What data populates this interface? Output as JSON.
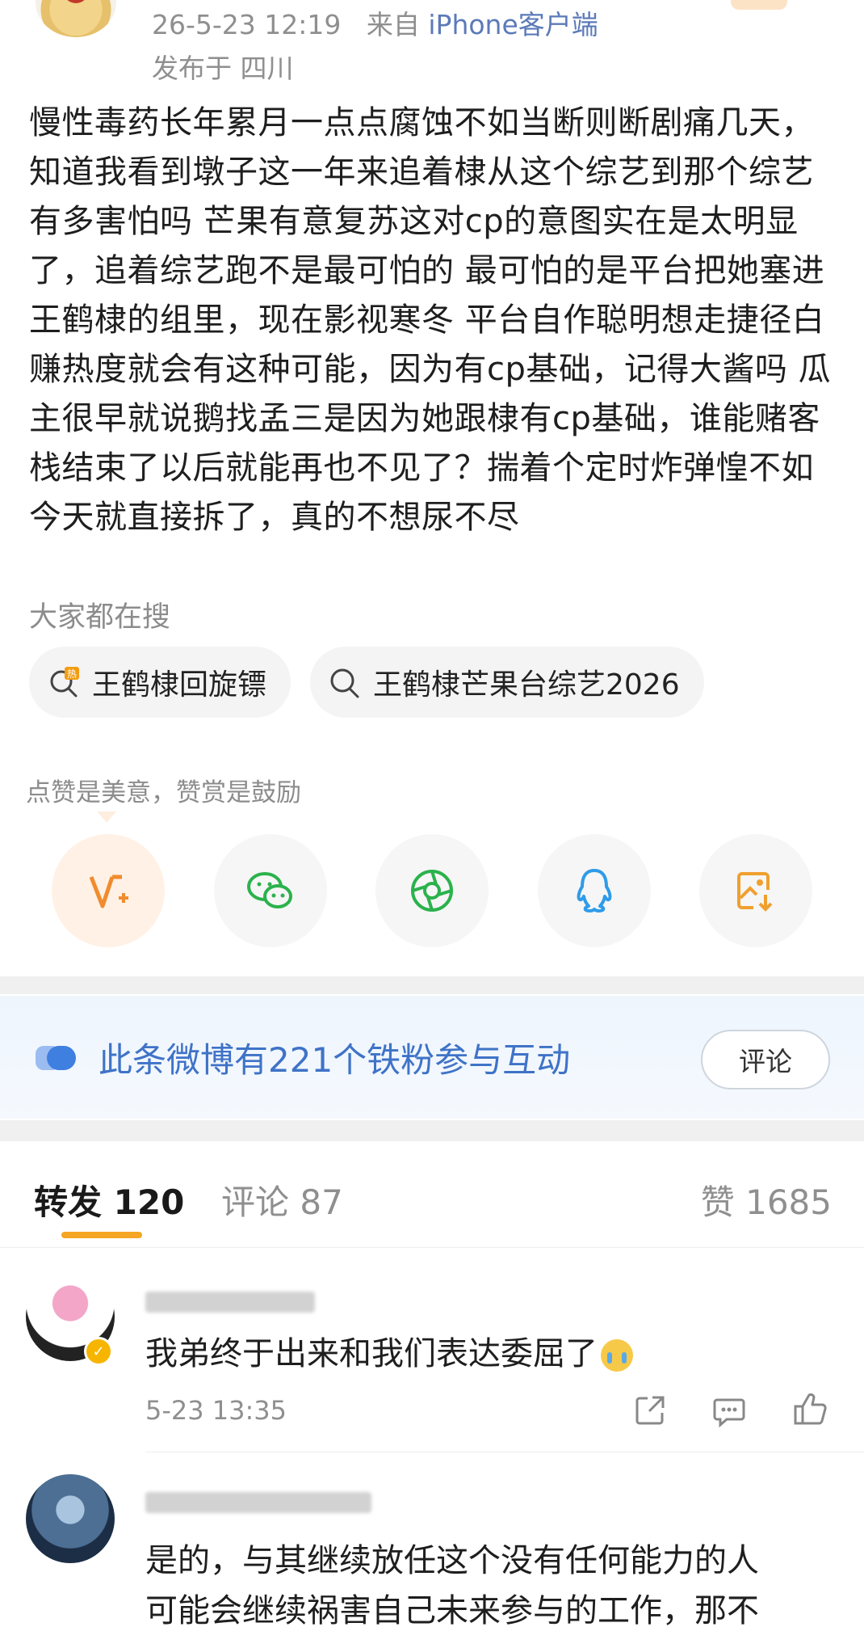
{
  "post": {
    "time": "26-5-23 12:19",
    "source_prefix": "来自",
    "source": "iPhone客户端",
    "location": "发布于 四川",
    "text": "慢性毒药长年累月一点点腐蚀不如当断则断剧痛几天，知道我看到墩子这一年来追着棣从这个综艺到那个综艺有多害怕吗 芒果有意复苏这对cp的意图实在是太明显了，追着综艺跑不是最可怕的 最可怕的是平台把她塞进王鹤棣的组里，现在影视寒冬 平台自作聪明想走捷径白赚热度就会有这种可能，因为有cp基础，记得大酱吗 瓜主很早就说鹅找孟三是因为她跟棣有cp基础，谁能赌客栈结束了以后就能再也不见了？揣着个定时炸弹惶不如今天就直接拆了，真的不想尿不尽"
  },
  "hot_search": {
    "title": "大家都在搜",
    "items": [
      {
        "label": "王鹤棣回旋镖",
        "icon": "hot-search-icon"
      },
      {
        "label": "王鹤棣芒果台综艺2026",
        "icon": "search-icon"
      }
    ]
  },
  "reward_tip": "点赞是美意，赞赏是鼓励",
  "share": [
    {
      "name": "weibo-v-reward",
      "color": "#f08c2e"
    },
    {
      "name": "wechat",
      "color": "#2bb24c"
    },
    {
      "name": "moments",
      "color": "#2bb24c"
    },
    {
      "name": "qq",
      "color": "#2f9be8"
    },
    {
      "name": "save-image",
      "color": "#f0a02e"
    }
  ],
  "fans_banner": {
    "text": "此条微博有221个铁粉参与互动",
    "button": "评论"
  },
  "tabs": {
    "repost": "转发 120",
    "comment": "评论 87",
    "like": "赞 1685"
  },
  "comments": [
    {
      "text": "我弟终于出来和我们表达委屈了",
      "emoji": "cry-emoji",
      "time": "5-23 13:35"
    },
    {
      "line1": "是的，与其继续放任这个没有任何能力的人",
      "line2": "可能会继续祸害自己未来参与的工作，那不"
    }
  ],
  "colors": {
    "accent": "#f5a623",
    "link": "#5b7ab8",
    "banner_text": "#3f73c7"
  }
}
